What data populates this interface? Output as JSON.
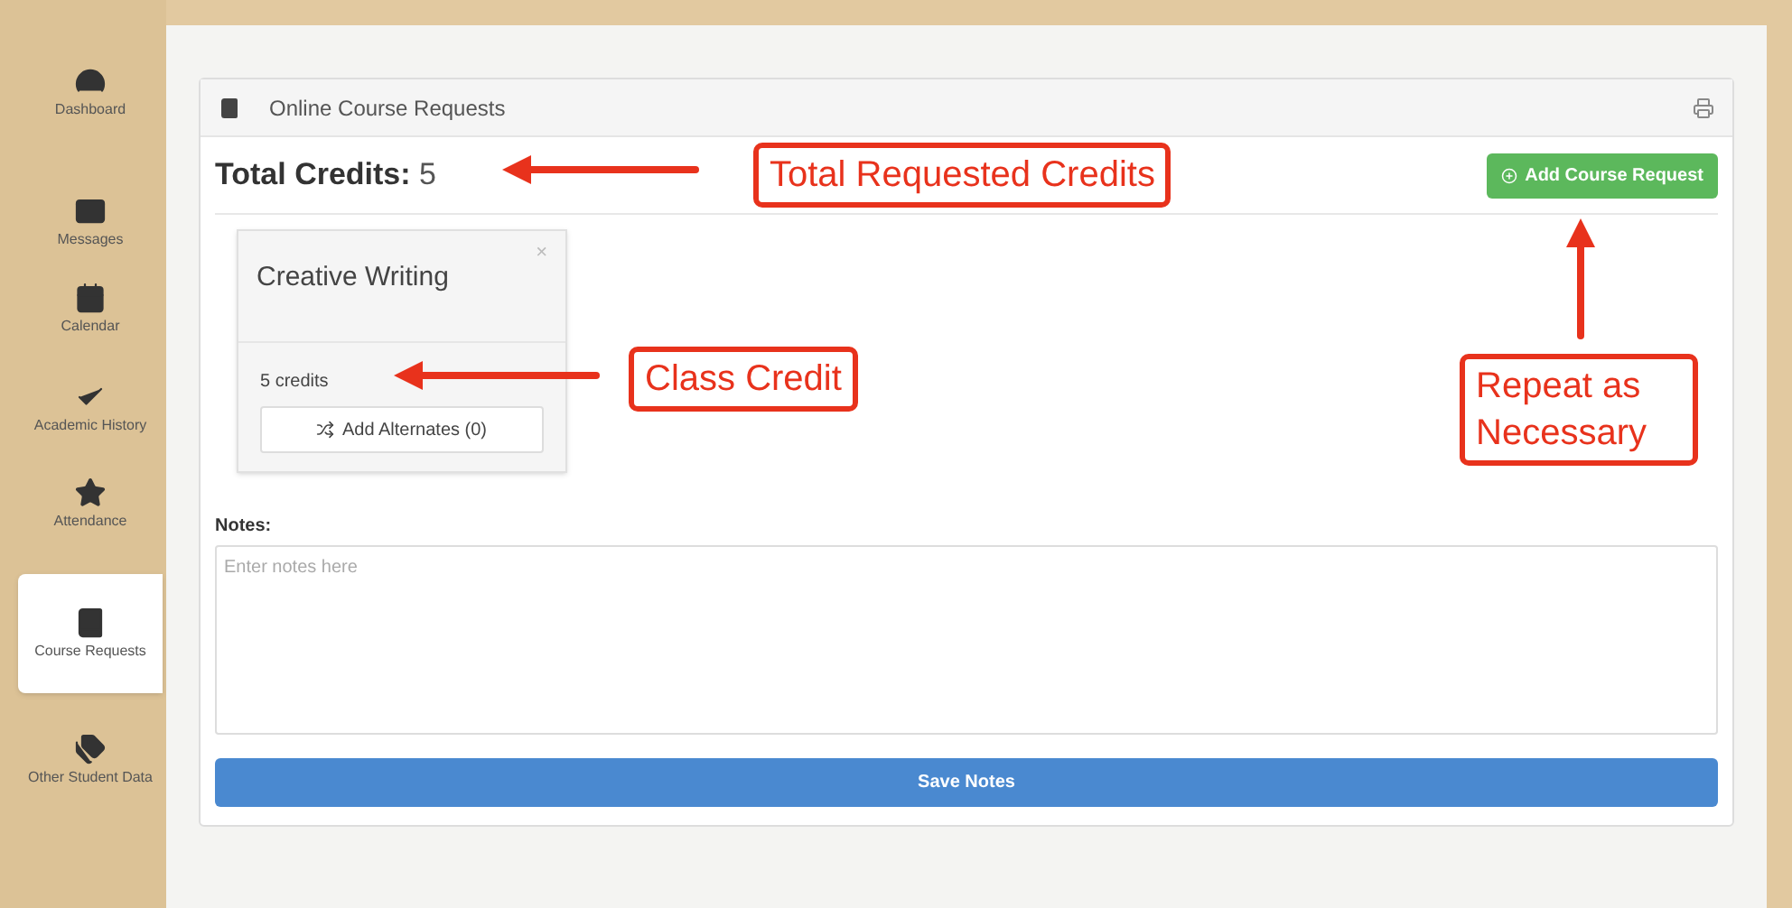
{
  "sidebar": {
    "items": [
      {
        "label": "Dashboard",
        "selected": false
      },
      {
        "label": "Messages",
        "selected": false
      },
      {
        "label": "Calendar",
        "selected": false
      },
      {
        "label": "Academic History",
        "selected": false
      },
      {
        "label": "Attendance",
        "selected": false
      },
      {
        "label": "Course Requests",
        "selected": true
      },
      {
        "label": "Other Student Data",
        "selected": false
      }
    ]
  },
  "panel": {
    "title": "Online Course Requests",
    "total_label": "Total Credits:",
    "total_value": "5",
    "add_button": "Add Course Request",
    "courses": [
      {
        "name": "Creative Writing",
        "close": "×",
        "credits": "5 credits",
        "alternates_button": "Add Alternates (0)"
      }
    ],
    "notes_label": "Notes:",
    "notes_placeholder": "Enter notes here",
    "save_button": "Save Notes"
  },
  "annotations": [
    {
      "text": "Total Requested Credits",
      "kind": "left"
    },
    {
      "text": "Class Credit",
      "kind": "left"
    },
    {
      "text": "Repeat as Necessary",
      "kind": "up"
    }
  ]
}
